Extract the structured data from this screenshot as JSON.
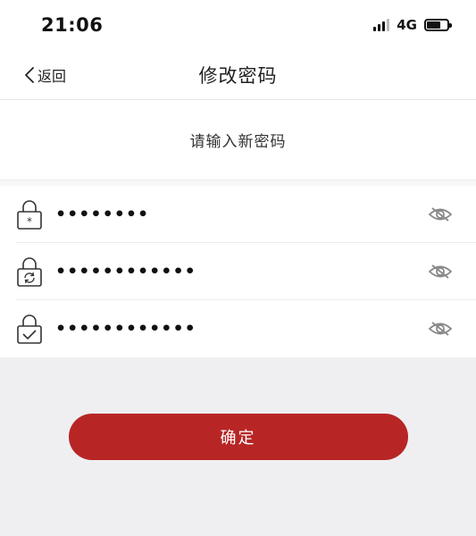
{
  "status_bar": {
    "time": "21:06",
    "network": "4G",
    "signal_icon": "signal-icon",
    "battery_icon": "battery-icon"
  },
  "nav": {
    "back_label": "返回",
    "title": "修改密码"
  },
  "prompt": "请输入新密码",
  "fields": [
    {
      "icon": "lock-asterisk-icon",
      "value": "••••••••",
      "toggle_icon": "eye-hidden-icon"
    },
    {
      "icon": "lock-refresh-icon",
      "value": "••••••••••••",
      "toggle_icon": "eye-hidden-icon"
    },
    {
      "icon": "lock-check-icon",
      "value": "••••••••••••",
      "toggle_icon": "eye-hidden-icon"
    }
  ],
  "confirm_label": "确定",
  "colors": {
    "accent": "#b72625",
    "background": "#efeff1"
  }
}
